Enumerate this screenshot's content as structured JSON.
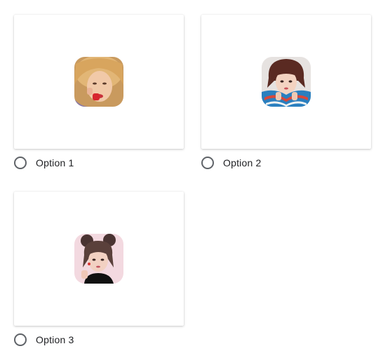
{
  "options": [
    {
      "label": "Option 1",
      "selected": false,
      "image": "portrait-photo-blonde-hair"
    },
    {
      "label": "Option 2",
      "selected": false,
      "image": "portrait-photo-striped-scarf"
    },
    {
      "label": "Option 3",
      "selected": false,
      "image": "portrait-photo-space-buns"
    }
  ],
  "colors": {
    "radio_border": "#5f6368",
    "label_text": "#202124",
    "card_background": "#ffffff"
  }
}
